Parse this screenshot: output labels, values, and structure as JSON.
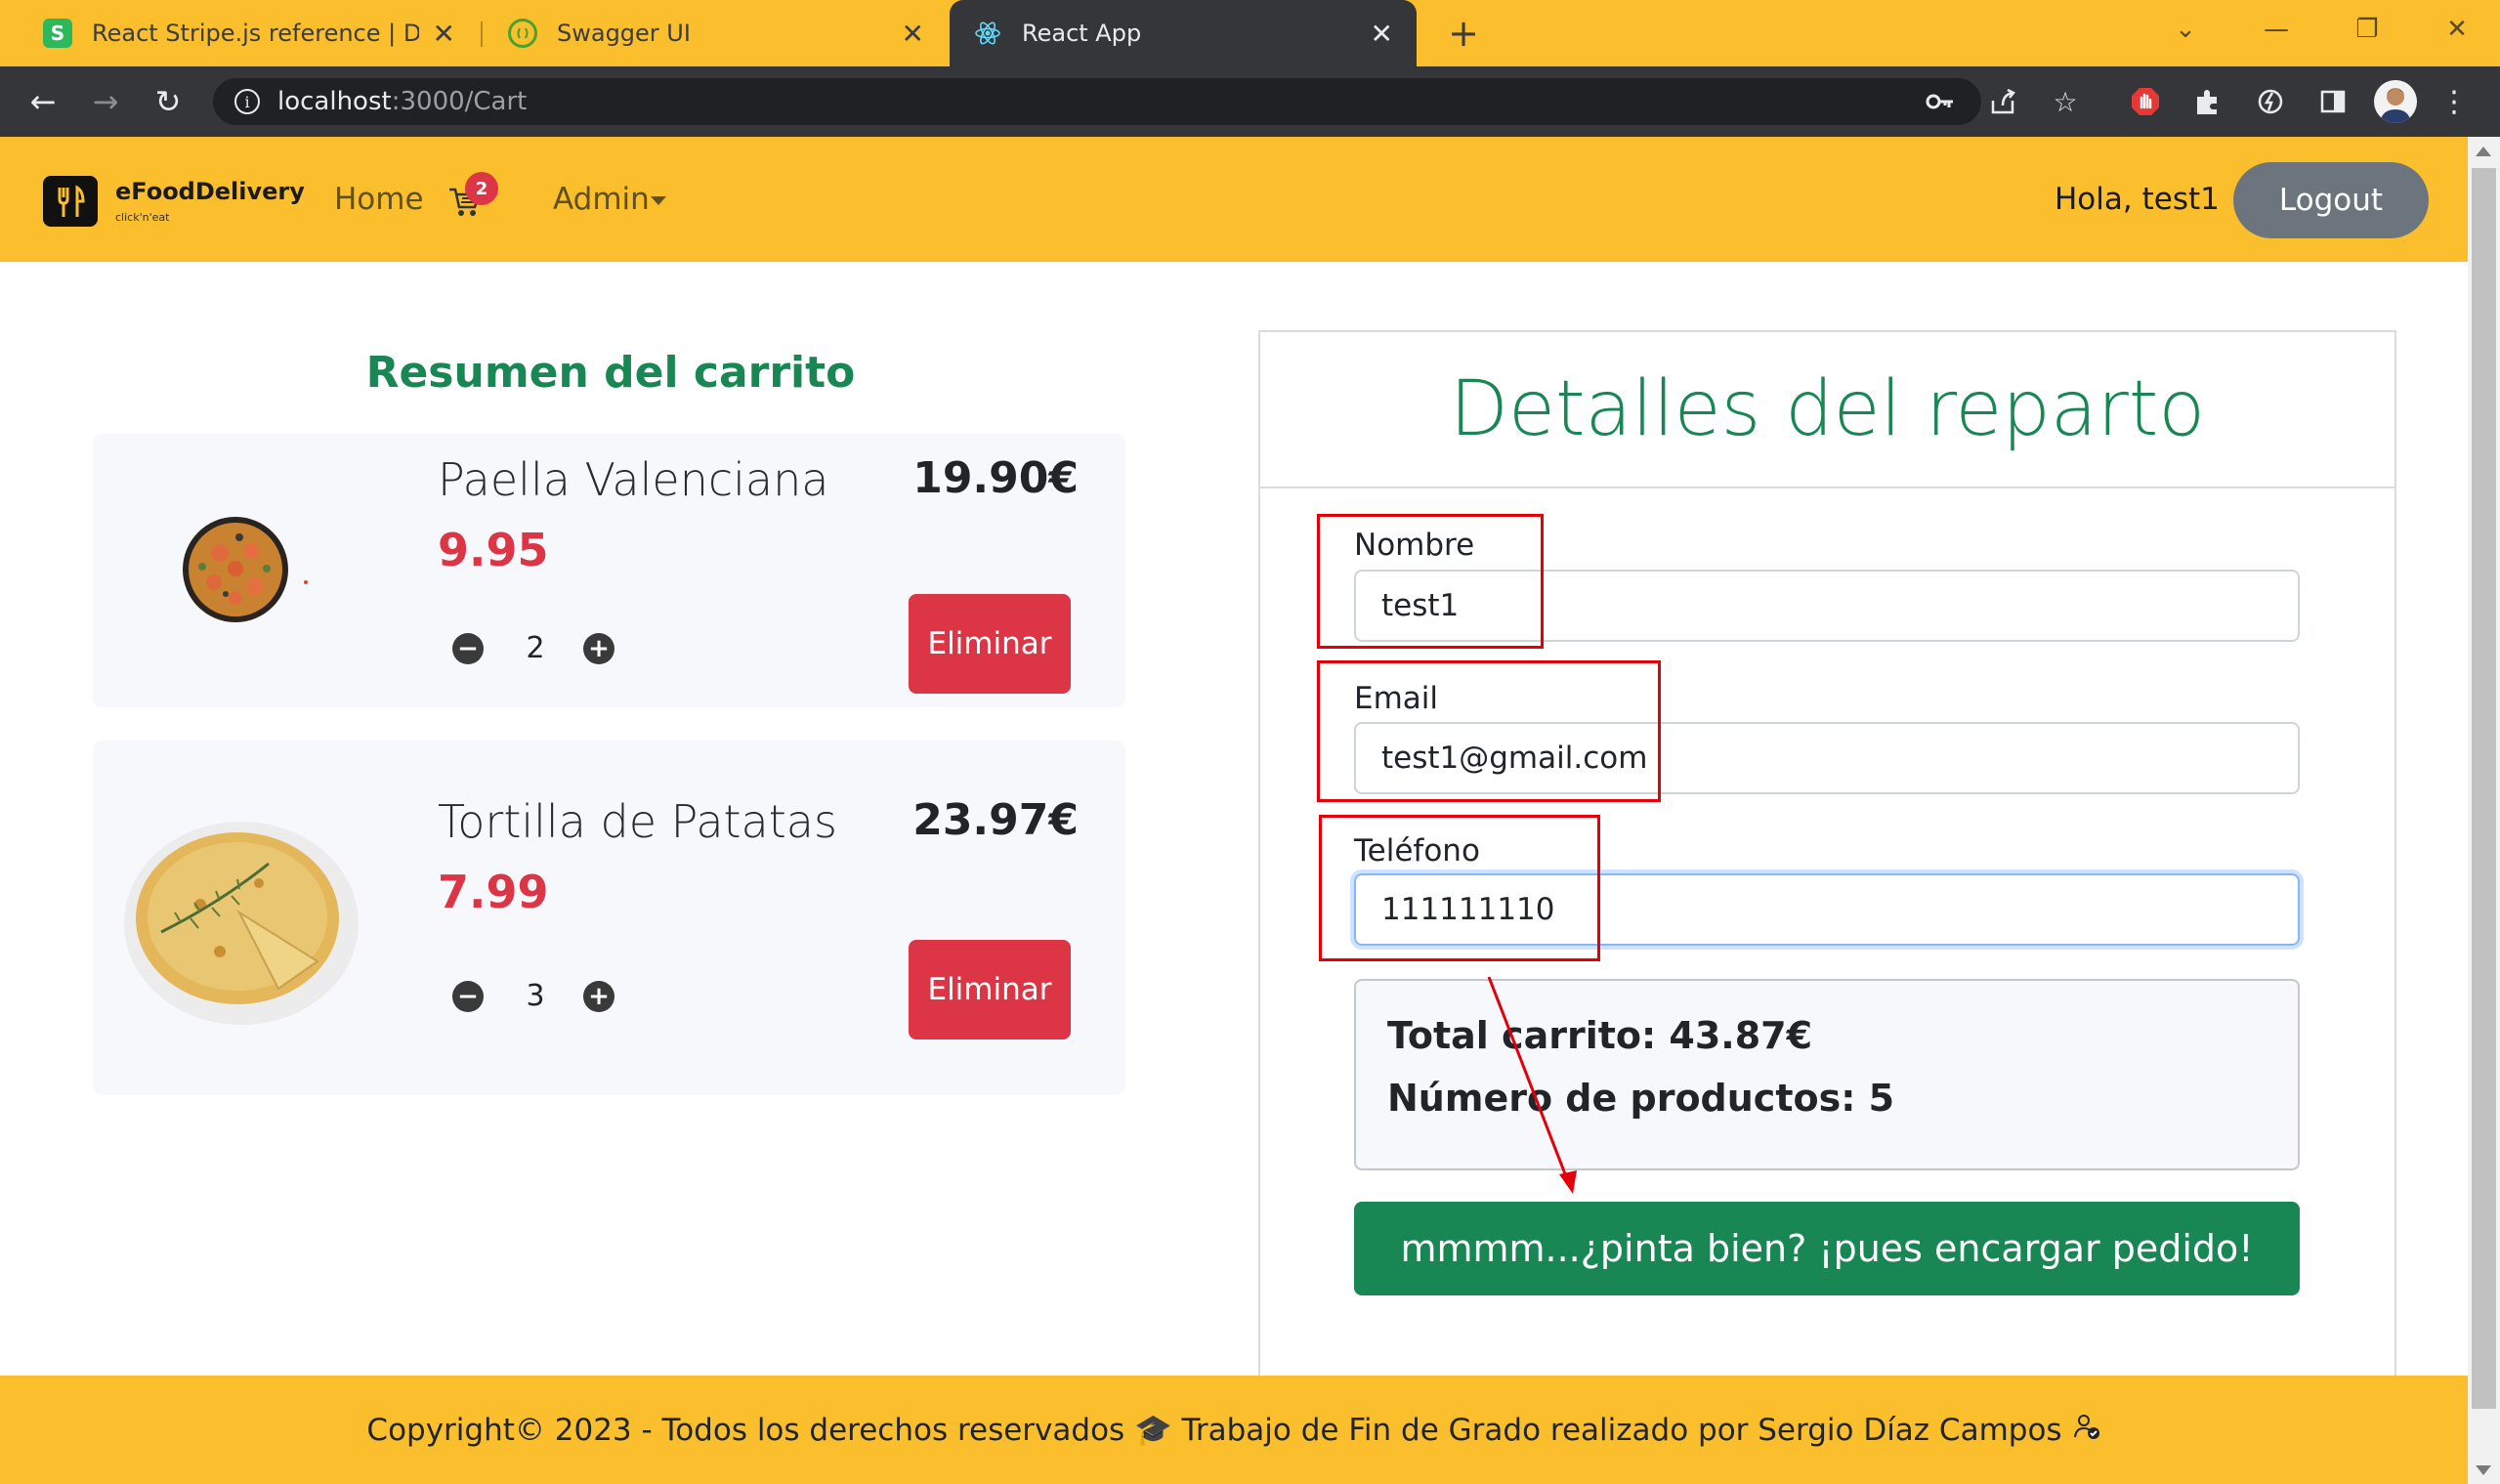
{
  "browser": {
    "tabs": [
      {
        "title": "React Stripe.js reference | Docum",
        "favicon": "S",
        "favicon_color": "#2eb85c"
      },
      {
        "title": "Swagger UI",
        "favicon": "swagger-icon",
        "favicon_color": "#85ea2d"
      },
      {
        "title": "React App",
        "favicon": "react-icon",
        "favicon_color": "#61dafb"
      }
    ],
    "active_tab": 2,
    "url_host": "localhost",
    "url_path": ":3000/Cart"
  },
  "navbar": {
    "brand": "eFoodDelivery",
    "tagline": "click'n'eat",
    "home": "Home",
    "cart_count": "2",
    "admin": "Admin",
    "greeting": "Hola, test1",
    "logout": "Logout"
  },
  "cart": {
    "title": "Resumen del carrito",
    "items": [
      {
        "name": "Paella Valenciana",
        "price": "9.95",
        "quantity": "2",
        "total": "19.90€",
        "remove": "Eliminar"
      },
      {
        "name": "Tortilla de Patatas",
        "price": "7.99",
        "quantity": "3",
        "total": "23.97€",
        "remove": "Eliminar"
      }
    ]
  },
  "delivery": {
    "title": "Detalles del reparto",
    "name_label": "Nombre",
    "name_value": "test1",
    "email_label": "Email",
    "email_value": "test1@gmail.com",
    "phone_label": "Teléfono",
    "phone_value": "111111110",
    "total_line": "Total carrito: 43.87€",
    "count_line": "Número de productos: 5",
    "order_button": "mmmm...¿pinta bien? ¡pues encargar pedido!"
  },
  "footer": {
    "text": "Copyright© 2023 - Todos los derechos reservados 🎓 Trabajo de Fin de Grado realizado por Sergio Díaz Campos"
  },
  "colors": {
    "brand_yellow": "#fbbf2e",
    "success_green": "#198754",
    "danger_red": "#dc3545",
    "annotation_red": "#e3000b"
  }
}
